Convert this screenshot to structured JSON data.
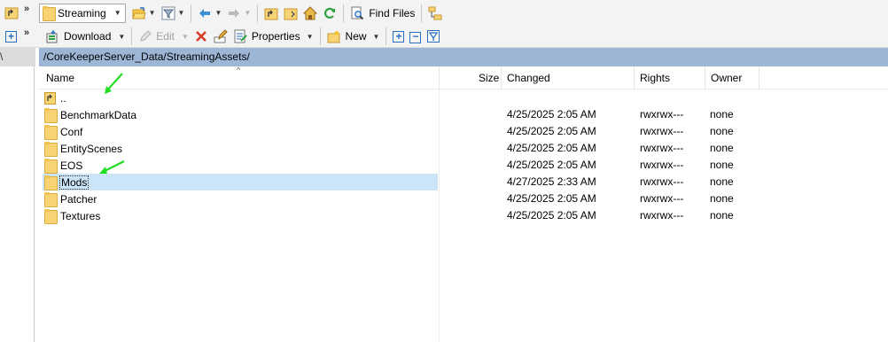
{
  "toolbar1": {
    "location_combo": "Streaming",
    "find_files_label": "Find Files"
  },
  "toolbar2": {
    "download_label": "Download",
    "edit_label": "Edit",
    "properties_label": "Properties",
    "new_label": "New"
  },
  "left_panel": {
    "path_stub": "\\"
  },
  "path": "/CoreKeeperServer_Data/StreamingAssets/",
  "columns": {
    "name": "Name",
    "size": "Size",
    "changed": "Changed",
    "rights": "Rights",
    "owner": "Owner"
  },
  "parent_entry": "..",
  "files": [
    {
      "name": "BenchmarkData",
      "changed": "4/25/2025 2:05 AM",
      "rights": "rwxrwx---",
      "owner": "none"
    },
    {
      "name": "Conf",
      "changed": "4/25/2025 2:05 AM",
      "rights": "rwxrwx---",
      "owner": "none"
    },
    {
      "name": "EntityScenes",
      "changed": "4/25/2025 2:05 AM",
      "rights": "rwxrwx---",
      "owner": "none"
    },
    {
      "name": "EOS",
      "changed": "4/25/2025 2:05 AM",
      "rights": "rwxrwx---",
      "owner": "none"
    },
    {
      "name": "Mods",
      "changed": "4/27/2025 2:33 AM",
      "rights": "rwxrwx---",
      "owner": "none"
    },
    {
      "name": "Patcher",
      "changed": "4/25/2025 2:05 AM",
      "rights": "rwxrwx---",
      "owner": "none"
    },
    {
      "name": "Textures",
      "changed": "4/25/2025 2:05 AM",
      "rights": "rwxrwx---",
      "owner": "none"
    }
  ],
  "selected_file": "Mods",
  "colors": {
    "path_bar": "#9db6d6",
    "selection": "#cce4f7",
    "annotation_arrow": "#22dd22",
    "folder": "#f7d373"
  }
}
